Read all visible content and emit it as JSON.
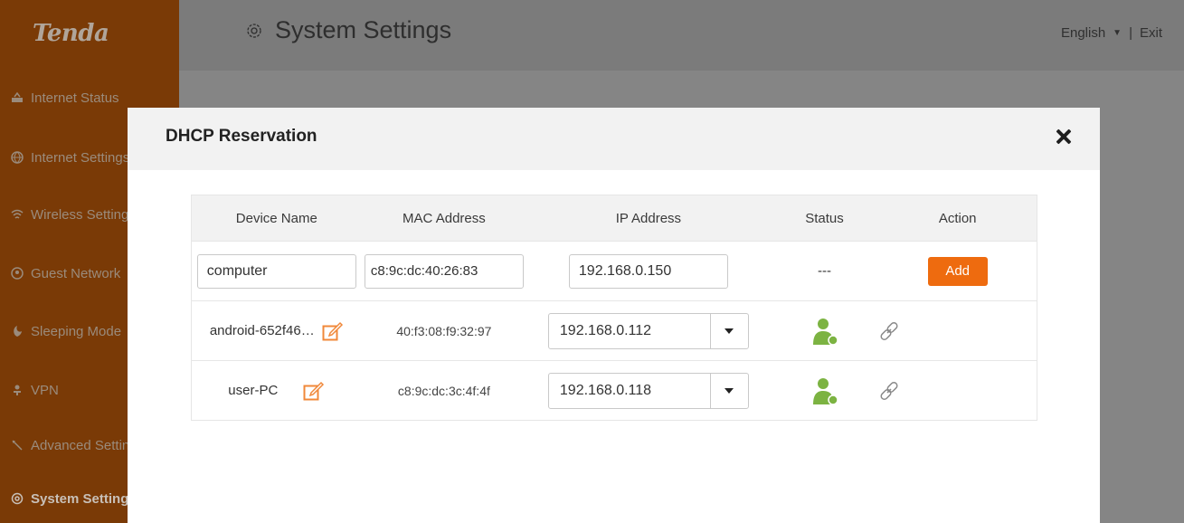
{
  "sidebar": {
    "logo": "Tenda",
    "items": [
      {
        "label": "Internet Status",
        "icon": "router-icon"
      },
      {
        "label": "Internet Settings",
        "icon": "globe-icon"
      },
      {
        "label": "Wireless Settings",
        "icon": "wifi-icon"
      },
      {
        "label": "Guest Network",
        "icon": "guest-icon"
      },
      {
        "label": "Sleeping Mode",
        "icon": "moon-icon"
      },
      {
        "label": "VPN",
        "icon": "vpn-icon"
      },
      {
        "label": "Advanced Settings",
        "icon": "wrench-icon"
      },
      {
        "label": "System Settings",
        "icon": "gear-icon",
        "active": true
      }
    ]
  },
  "header": {
    "title": "System Settings",
    "language": "English",
    "separator": "|",
    "exit": "Exit"
  },
  "modal": {
    "title": "DHCP Reservation",
    "columns": [
      "Device Name",
      "MAC Address",
      "IP Address",
      "Status",
      "Action"
    ],
    "new_entry": {
      "device_name": "computer",
      "mac": "c8:9c:dc:40:26:83",
      "ip": "192.168.0.150",
      "status": "---",
      "add_label": "Add"
    },
    "rows": [
      {
        "device_name": "android-652f46…",
        "mac": "40:f3:08:f9:32:97",
        "ip": "192.168.0.112",
        "status_icon": "user-online-icon",
        "action_icon": "link-icon"
      },
      {
        "device_name": "user-PC",
        "mac": "c8:9c:dc:3c:4f:4f",
        "ip": "192.168.0.118",
        "status_icon": "user-online-icon",
        "action_icon": "link-icon"
      }
    ]
  },
  "colors": {
    "accent": "#ee6b0f",
    "sidebar": "#7a3a06",
    "status_green": "#7cb342"
  }
}
